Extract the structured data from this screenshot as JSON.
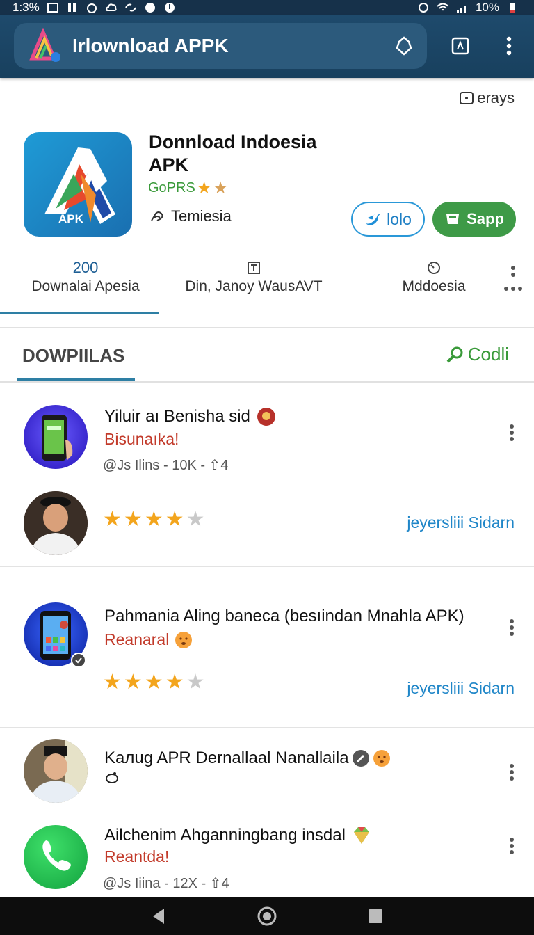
{
  "status_bar": {
    "time": "1:3%",
    "battery": "10%"
  },
  "app_bar": {
    "title": "Irlownload APPK"
  },
  "header": {
    "top_meta": "erays",
    "app_name": "Donnload Indoesia APK",
    "rating_label": "GoPRS",
    "developer": "Temiesia",
    "btn_secondary": "lolo",
    "btn_primary": "Sapp"
  },
  "stats": [
    {
      "top": "200",
      "bottom": "Downalai Apesia"
    },
    {
      "top": "",
      "bottom": "Din, Janoy WausAVT"
    },
    {
      "top": "",
      "bottom": "Mddoesia"
    }
  ],
  "section": {
    "title": "DOWPIILAS",
    "action": "Codli"
  },
  "items": [
    {
      "title": "Yiluir aı Benisha sid",
      "subtitle": "Bisunaıka!",
      "meta": "@Js Ilins - 10K - ⇧4",
      "stars": 4,
      "link": "jeyersliii Sidarn"
    },
    {
      "title": "Pahmania Aling baneca (besıindan Mnahla APK)",
      "subtitle": "Reanaral",
      "stars": 4,
      "link": "jeyersliii Sidarn"
    },
    {
      "title": "Kaлug APR Dernallaal Nanallaila"
    },
    {
      "title": "Ailchenim Ahganningbang insdal",
      "subtitle": "Reantda!",
      "meta": "@Js Iiina - 12X - ⇧4"
    }
  ],
  "colors": {
    "app_bar": "#1e4a6c",
    "accent_blue": "#2e7fa4",
    "green": "#3e9a47",
    "red_text": "#c23a2a",
    "star": "#f3a51d",
    "link": "#1f86c8"
  }
}
